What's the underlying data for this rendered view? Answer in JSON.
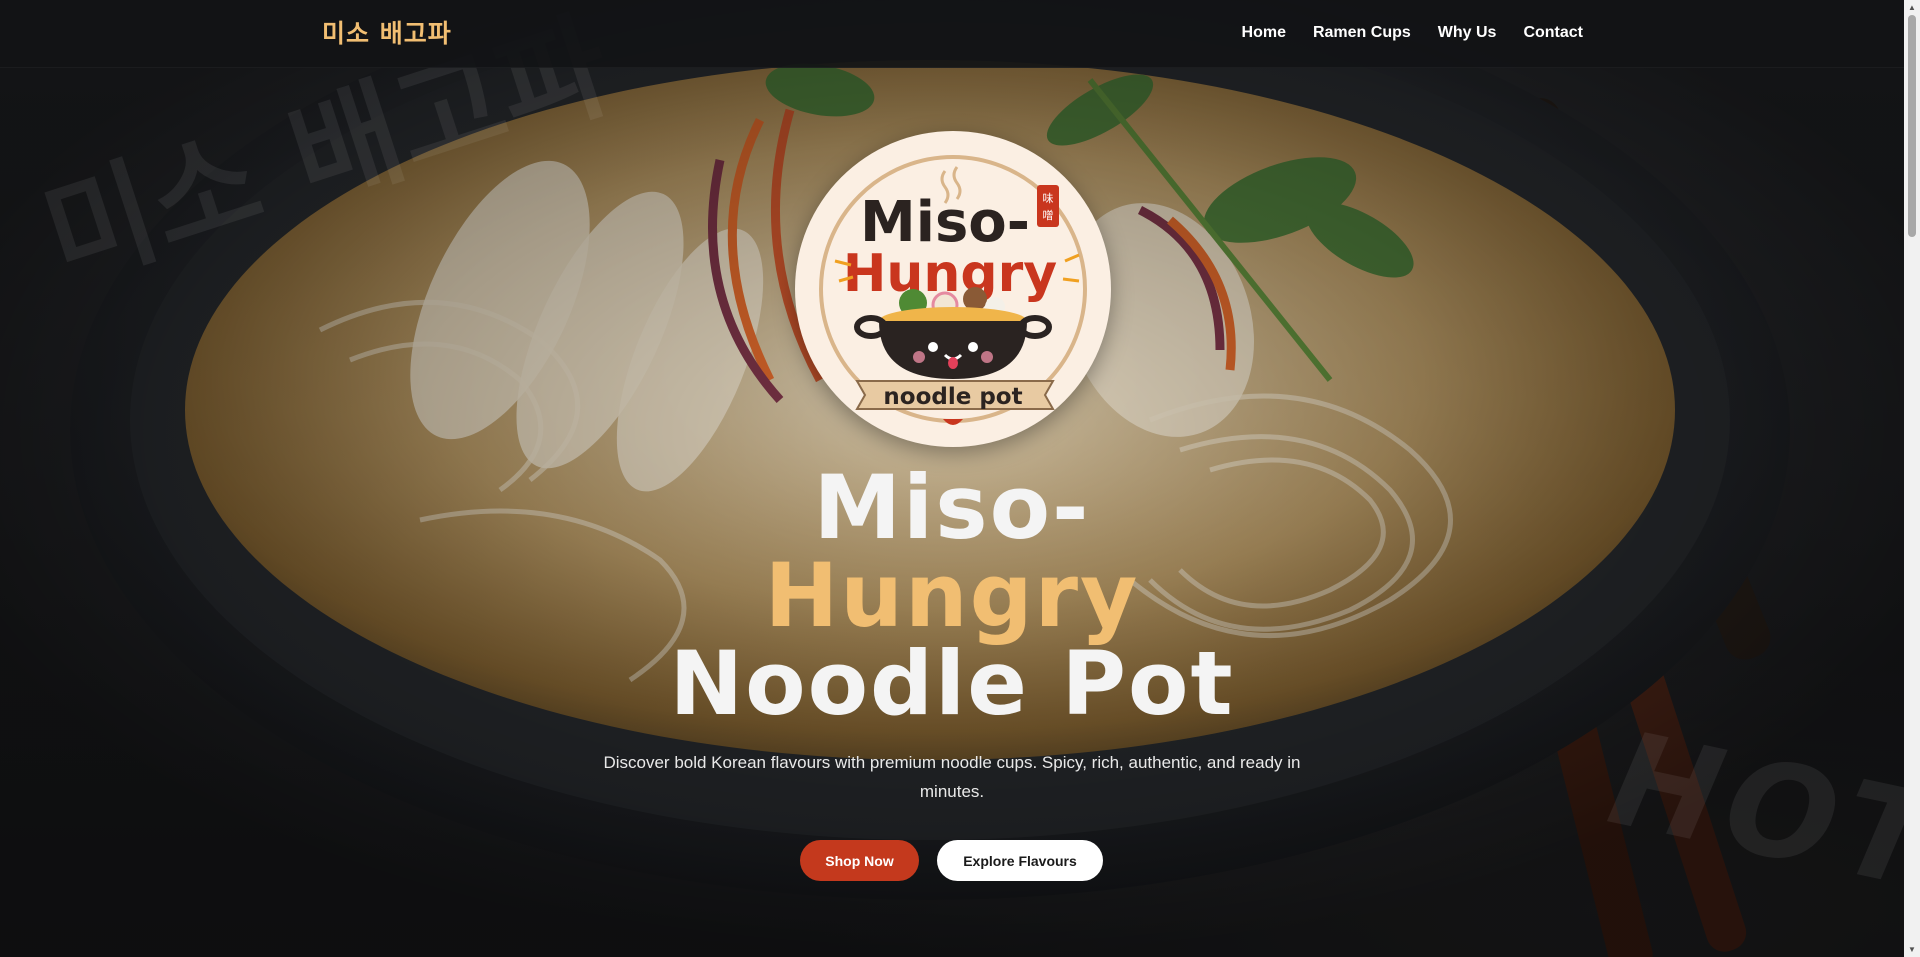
{
  "nav": {
    "brand": "미소 배고파",
    "links": [
      "Home",
      "Ramen Cups",
      "Why Us",
      "Contact"
    ]
  },
  "watermarks": {
    "korean": "미소 배고파",
    "hot": "HOT"
  },
  "logo": {
    "line1": "Miso-",
    "line2": "Hungry",
    "ribbon": "noodle pot",
    "stamp": "味噌"
  },
  "hero": {
    "title_line1": "Miso-",
    "title_line2": "Hungry",
    "title_line3": "Noodle Pot",
    "subtitle": "Discover bold Korean flavours with premium noodle cups. Spicy, rich, authentic, and ready in minutes.",
    "primary_button": "Shop Now",
    "secondary_button": "Explore Flavours"
  },
  "colors": {
    "accent_gold": "#f1be72",
    "brand_red": "#c4391d",
    "nav_bg": "#121315",
    "logo_cream": "#fbefe3"
  },
  "icons": [
    "chevron-up-icon",
    "chevron-down-icon"
  ]
}
